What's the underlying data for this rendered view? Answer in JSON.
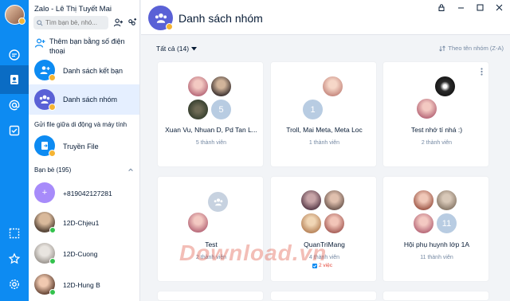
{
  "app": {
    "title": "Zalo - Lê Thị Tuyết Mai",
    "search_placeholder": "Tìm bạn bè, nhó..."
  },
  "sidebar": {
    "items": [
      {
        "label": "Thêm bạn bằng số điện thoại",
        "icon": "add-contact-icon"
      },
      {
        "label": "Danh sách kết bạn",
        "icon": "friend-request-icon"
      },
      {
        "label": "Danh sách nhóm",
        "icon": "group-icon"
      }
    ],
    "transfer_heading": "Gửi file giữa di động và máy tính",
    "transfer_label": "Truyền File",
    "friends_heading": "Bạn bè (195)",
    "friends": [
      {
        "name": "+819042127281"
      },
      {
        "name": "12D-Chjeu1"
      },
      {
        "name": "12D-Cuong"
      },
      {
        "name": "12D-Hung B"
      }
    ]
  },
  "main": {
    "title": "Danh sách nhóm",
    "filter_label": "Tất cả (14)",
    "sort_label": "Theo tên nhóm (Z-A)",
    "groups": [
      {
        "name": "Xuan Vu, Nhuan D, Pd Tan L...",
        "members": "5 thành viên",
        "extra_count": "5"
      },
      {
        "name": "Troll, Mai Meta, Meta Loc",
        "members": "1 thành viên",
        "extra_count": "1"
      },
      {
        "name": "Test nhớ tí nhá :)",
        "members": "2 thành viên"
      },
      {
        "name": "Test",
        "members": "2 thành viên"
      },
      {
        "name": "QuanTriMang",
        "members": "4 thành viên",
        "tag": "2 việc"
      },
      {
        "name": "Hội phụ huynh lớp 1A",
        "members": "11 thành viên",
        "extra_count": "11"
      }
    ]
  },
  "watermark": "Download.vn",
  "colors": {
    "accent": "#0d8bf2",
    "group_icon": "#5a61d6",
    "active_bg": "#e5efff"
  }
}
